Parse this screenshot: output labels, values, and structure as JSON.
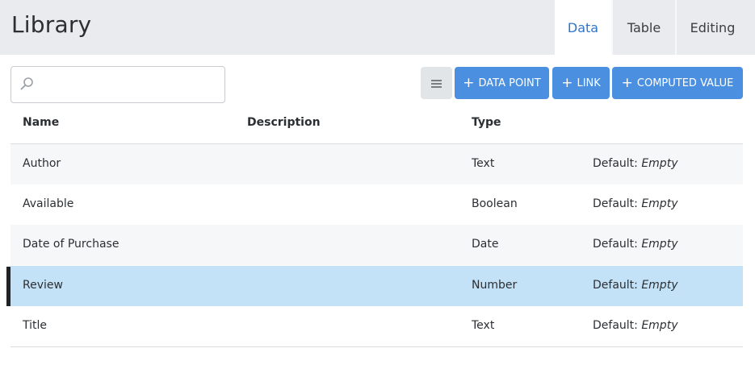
{
  "header": {
    "title": "Library",
    "tabs": [
      {
        "label": "Data",
        "active": true
      },
      {
        "label": "Table",
        "active": false
      },
      {
        "label": "Editing",
        "active": false
      }
    ]
  },
  "toolbar": {
    "search_value": "",
    "search_placeholder": "",
    "menu_icon": "list-icon",
    "data_point_label": "DATA POINT",
    "link_label": "LINK",
    "computed_value_label": "COMPUTED VALUE",
    "button_color": "#4a8fe0"
  },
  "table": {
    "columns": [
      "Name",
      "Description",
      "Type"
    ],
    "rows": [
      {
        "name": "Author",
        "description": "",
        "type": "Text",
        "default_label": "Default:",
        "default_value": "Empty"
      },
      {
        "name": "Available",
        "description": "",
        "type": "Boolean",
        "default_label": "Default:",
        "default_value": "Empty"
      },
      {
        "name": "Date of Purchase",
        "description": "",
        "type": "Date",
        "default_label": "Default:",
        "default_value": "Empty"
      },
      {
        "name": "Review",
        "description": "",
        "type": "Number",
        "default_label": "Default:",
        "default_value": "Empty",
        "selected": true
      },
      {
        "name": "Title",
        "description": "",
        "type": "Text",
        "default_label": "Default:",
        "default_value": "Empty"
      }
    ],
    "selected_row_color": "#c4e2f7",
    "accent_color": "#2f76c9"
  }
}
